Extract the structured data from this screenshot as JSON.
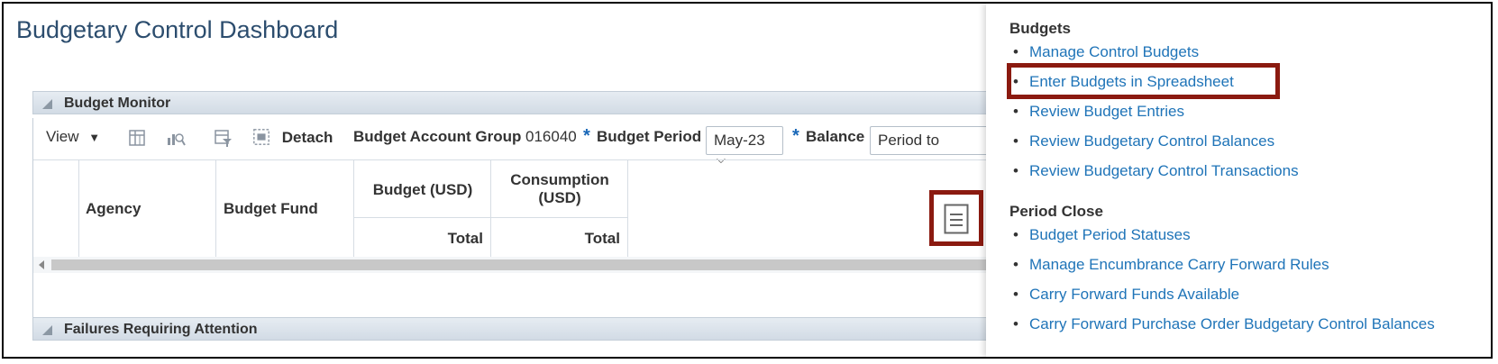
{
  "page": {
    "title": "Budgetary Control Dashboard"
  },
  "budget_monitor": {
    "title": "Budget Monitor",
    "toolbar": {
      "view_label": "View",
      "detach_label": "Detach",
      "account_group_label": "Budget Account Group",
      "account_group_value": "016040",
      "required_marker": "*",
      "period_label": "Budget Period",
      "period_value": "May-23",
      "balance_label": "Balance",
      "balance_value": "Period to"
    },
    "columns": {
      "agency": "Agency",
      "budget_fund": "Budget Fund",
      "budget_usd": "Budget (USD)",
      "consumption_usd": "Consumption (USD)",
      "total_1": "Total",
      "total_2": "Total"
    }
  },
  "failures": {
    "title": "Failures Requiring Attention"
  },
  "tasks": {
    "budgets": {
      "title": "Budgets",
      "items": [
        "Manage Control Budgets",
        "Enter Budgets in Spreadsheet",
        "Review Budget Entries",
        "Review Budgetary Control Balances",
        "Review Budgetary Control Transactions"
      ]
    },
    "period_close": {
      "title": "Period Close",
      "items": [
        "Budget Period Statuses",
        "Manage Encumbrance Carry Forward Rules",
        "Carry Forward Funds Available",
        "Carry Forward Purchase Order Budgetary Control Balances"
      ]
    }
  },
  "colors": {
    "link": "#1f74b8",
    "highlight": "#8b1a10",
    "title": "#2c4d6e"
  }
}
